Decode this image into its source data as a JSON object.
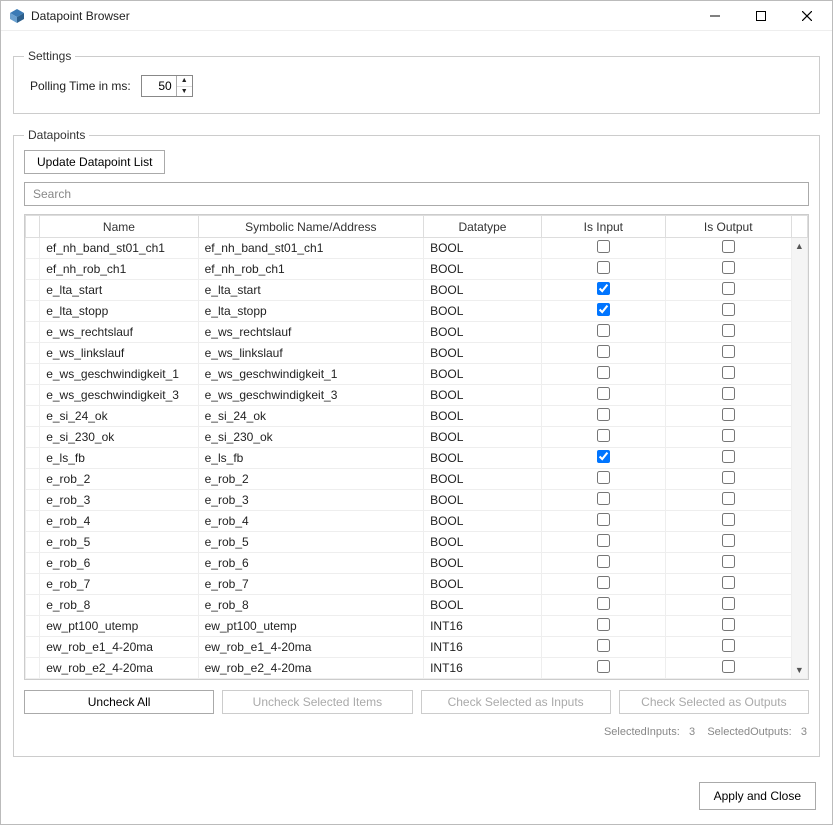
{
  "window": {
    "title": "Datapoint Browser"
  },
  "settings": {
    "legend": "Settings",
    "polling_label": "Polling Time in ms:",
    "polling_value": "50"
  },
  "datapoints": {
    "legend": "Datapoints",
    "update_btn": "Update Datapoint List",
    "search_placeholder": "Search",
    "columns": {
      "name": "Name",
      "sym": "Symbolic Name/Address",
      "type": "Datatype",
      "input": "Is Input",
      "output": "Is Output"
    },
    "rows": [
      {
        "name": "ef_nh_band_st01_ch1",
        "sym": "ef_nh_band_st01_ch1",
        "type": "BOOL",
        "input": false,
        "output": false
      },
      {
        "name": "ef_nh_rob_ch1",
        "sym": "ef_nh_rob_ch1",
        "type": "BOOL",
        "input": false,
        "output": false
      },
      {
        "name": "e_lta_start",
        "sym": "e_lta_start",
        "type": "BOOL",
        "input": true,
        "output": false
      },
      {
        "name": "e_lta_stopp",
        "sym": "e_lta_stopp",
        "type": "BOOL",
        "input": true,
        "output": false
      },
      {
        "name": "e_ws_rechtslauf",
        "sym": "e_ws_rechtslauf",
        "type": "BOOL",
        "input": false,
        "output": false
      },
      {
        "name": "e_ws_linkslauf",
        "sym": "e_ws_linkslauf",
        "type": "BOOL",
        "input": false,
        "output": false
      },
      {
        "name": "e_ws_geschwindigkeit_1",
        "sym": "e_ws_geschwindigkeit_1",
        "type": "BOOL",
        "input": false,
        "output": false
      },
      {
        "name": "e_ws_geschwindigkeit_3",
        "sym": "e_ws_geschwindigkeit_3",
        "type": "BOOL",
        "input": false,
        "output": false
      },
      {
        "name": "e_si_24_ok",
        "sym": "e_si_24_ok",
        "type": "BOOL",
        "input": false,
        "output": false
      },
      {
        "name": "e_si_230_ok",
        "sym": "e_si_230_ok",
        "type": "BOOL",
        "input": false,
        "output": false
      },
      {
        "name": "e_ls_fb",
        "sym": "e_ls_fb",
        "type": "BOOL",
        "input": true,
        "output": false
      },
      {
        "name": "e_rob_2",
        "sym": "e_rob_2",
        "type": "BOOL",
        "input": false,
        "output": false
      },
      {
        "name": "e_rob_3",
        "sym": "e_rob_3",
        "type": "BOOL",
        "input": false,
        "output": false
      },
      {
        "name": "e_rob_4",
        "sym": "e_rob_4",
        "type": "BOOL",
        "input": false,
        "output": false
      },
      {
        "name": "e_rob_5",
        "sym": "e_rob_5",
        "type": "BOOL",
        "input": false,
        "output": false
      },
      {
        "name": "e_rob_6",
        "sym": "e_rob_6",
        "type": "BOOL",
        "input": false,
        "output": false
      },
      {
        "name": "e_rob_7",
        "sym": "e_rob_7",
        "type": "BOOL",
        "input": false,
        "output": false
      },
      {
        "name": "e_rob_8",
        "sym": "e_rob_8",
        "type": "BOOL",
        "input": false,
        "output": false
      },
      {
        "name": "ew_pt100_utemp",
        "sym": "ew_pt100_utemp",
        "type": "INT16",
        "input": false,
        "output": false
      },
      {
        "name": "ew_rob_e1_4-20ma",
        "sym": "ew_rob_e1_4-20ma",
        "type": "INT16",
        "input": false,
        "output": false
      },
      {
        "name": "ew_rob_e2_4-20ma",
        "sym": "ew_rob_e2_4-20ma",
        "type": "INT16",
        "input": false,
        "output": false
      }
    ],
    "buttons": {
      "uncheck_all": "Uncheck All",
      "uncheck_selected": "Uncheck Selected Items",
      "check_inputs": "Check Selected as Inputs",
      "check_outputs": "Check Selected as Outputs"
    },
    "status": {
      "inputs_label": "SelectedInputs:",
      "inputs_count": "3",
      "outputs_label": "SelectedOutputs:",
      "outputs_count": "3"
    }
  },
  "footer": {
    "apply_close": "Apply and Close"
  }
}
